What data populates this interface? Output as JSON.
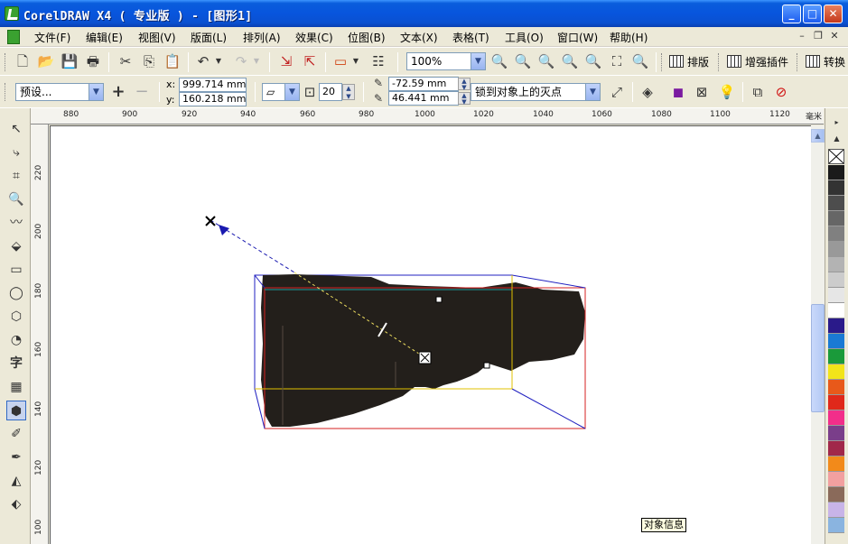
{
  "window": {
    "title": "CorelDRAW X4 ( 专业版 ) - [图形1]",
    "controls": [
      "_",
      "□",
      "✕"
    ]
  },
  "menu": [
    "文件(F)",
    "编辑(E)",
    "视图(V)",
    "版面(L)",
    "排列(A)",
    "效果(C)",
    "位图(B)",
    "文本(X)",
    "表格(T)",
    "工具(O)",
    "窗口(W)",
    "帮助(H)"
  ],
  "standard_toolbar": {
    "zoom": "100%",
    "plugins": [
      "排版",
      "增强插件",
      "转换"
    ]
  },
  "property_bar": {
    "preset": "预设...",
    "x_label": "x:",
    "x_value": "999.714 mm",
    "y_label": "y:",
    "y_value": "160.218 mm",
    "depth": "20",
    "vp_x": "-72.59 mm",
    "vp_y": "46.441 mm",
    "vp_lock": "锁到对象上的灭点"
  },
  "rulers": {
    "unit": "毫米",
    "top_ticks": [
      "880",
      "900",
      "920",
      "940",
      "960",
      "980",
      "1000",
      "1020",
      "1040",
      "1060",
      "1080",
      "1100",
      "1120"
    ],
    "left_ticks": [
      "220",
      "200",
      "180",
      "160",
      "140",
      "120",
      "100"
    ]
  },
  "status_tooltip": "对象信息",
  "colors": {
    "titlebar": "#0a5ddc",
    "shape_fill": "#231f1b",
    "bbox_front": "#d42020",
    "bbox_back": "#2020c0",
    "vanish_line": "#1a1ab0",
    "palette": [
      "#1a1a1a",
      "#333333",
      "#4d4d4d",
      "#666666",
      "#808080",
      "#999999",
      "#b3b3b3",
      "#cccccc",
      "#e6e6e6",
      "#ffffff",
      "#2a1a8a",
      "#1a7ad4",
      "#1a9a3a",
      "#f2e41a",
      "#e8591a",
      "#e0281a",
      "#f22e8a",
      "#7a3e8a",
      "#a1284a",
      "#f28a1a",
      "#f2a0a0",
      "#8a6a5a",
      "#c8b4e8",
      "#8ab4e0"
    ]
  }
}
